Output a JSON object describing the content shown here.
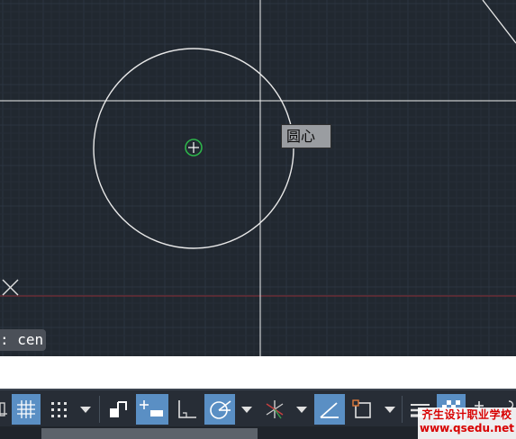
{
  "drawing": {
    "tooltip_text": "圆心",
    "command_text": ": cen"
  },
  "status_bar": {
    "buttons": [
      {
        "name": "model-space-icon",
        "active": false
      },
      {
        "name": "grid-display-icon",
        "active": true
      },
      {
        "name": "snap-mode-icon",
        "active": false
      },
      {
        "name": "snap-dropdown-icon",
        "active": false
      },
      {
        "name": "infer-constraints-icon",
        "active": false
      },
      {
        "name": "dynamic-input-icon",
        "active": true
      },
      {
        "name": "ortho-mode-icon",
        "active": false
      },
      {
        "name": "polar-tracking-icon",
        "active": true
      },
      {
        "name": "polar-dropdown-icon",
        "active": false
      },
      {
        "name": "isometric-drafting-icon",
        "active": false
      },
      {
        "name": "isometric-dropdown-icon",
        "active": false
      },
      {
        "name": "object-snap-tracking-icon",
        "active": true
      },
      {
        "name": "object-snap-icon",
        "active": false
      },
      {
        "name": "object-snap-dropdown-icon",
        "active": false
      },
      {
        "name": "lineweight-icon",
        "active": false
      },
      {
        "name": "transparency-icon",
        "active": true
      },
      {
        "name": "selection-cycling-icon",
        "active": false
      }
    ]
  },
  "watermark": {
    "line1": "齐生设计职业学校",
    "line2": "www.qsedu.net"
  },
  "colors": {
    "canvas_bg": "#212830",
    "grid_minor": "#262e38",
    "grid_major": "#2c3541",
    "crosshair": "#ffffff",
    "circle": "#ffffff",
    "snap_marker": "#2db34a",
    "x_axis": "#8a2c34",
    "button_active": "#5a8fc4"
  }
}
